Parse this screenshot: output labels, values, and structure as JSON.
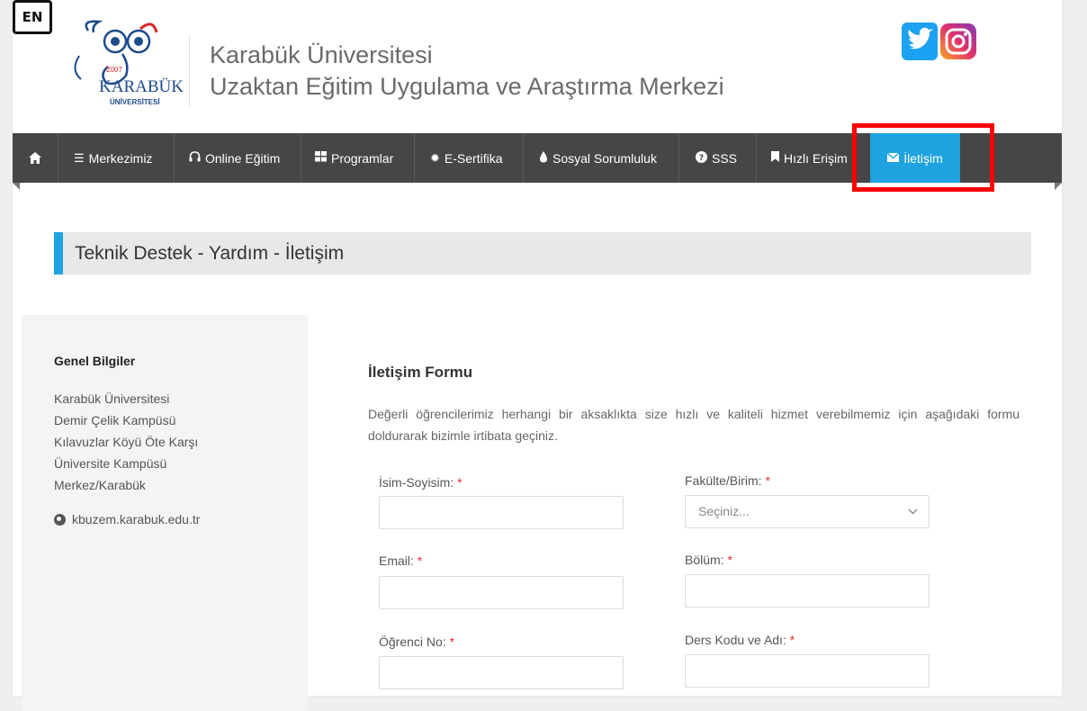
{
  "header": {
    "logo_year": "2007",
    "logo_name": "KARABÜK",
    "logo_sub": "ÜNİVERSİTESİ",
    "title_line1": "Karabük Üniversitesi",
    "title_line2": "Uzaktan Eğitim Uygulama ve Araştırma Merkezi",
    "lang_button": "EN"
  },
  "nav": {
    "items": [
      {
        "label": "Merkezimiz",
        "icon": "list-icon"
      },
      {
        "label": "Online Eğitim",
        "icon": "headphones-icon"
      },
      {
        "label": "Programlar",
        "icon": "grid-icon"
      },
      {
        "label": "E-Sertifika",
        "icon": "certificate-icon"
      },
      {
        "label": "Sosyal Sorumluluk",
        "icon": "drop-icon"
      },
      {
        "label": "SSS",
        "icon": "question-icon"
      },
      {
        "label": "Hızlı Erişim",
        "icon": "bookmark-icon"
      },
      {
        "label": "İletişim",
        "icon": "envelope-icon"
      }
    ],
    "active": "İletişim"
  },
  "section_title": "Teknik Destek - Yardım - İletişim",
  "sidebar": {
    "heading": "Genel Bilgiler",
    "address": [
      "Karabük Üniversitesi",
      "Demir Çelik Kampüsü",
      "Kılavuzlar Köyü Öte Karşı",
      "Üniversite Kampüsü",
      "Merkez/Karabük"
    ],
    "website": "kbuzem.karabuk.edu.tr"
  },
  "form": {
    "title": "İletişim Formu",
    "description": "Değerli öğrencilerimiz herhangi bir aksaklıkta size hızlı ve kaliteli hizmet verebilmemiz için aşağıdaki formu doldurarak bizimle irtibata geçiniz.",
    "required_mark": "*",
    "fields": {
      "name_label": "İsim-Soyisim:",
      "faculty_label": "Fakülte/Birim:",
      "faculty_placeholder": "Seçiniz...",
      "email_label": "Email:",
      "department_label": "Bölüm:",
      "student_no_label": "Öğrenci No:",
      "course_label": "Ders Kodu ve Adı:"
    }
  },
  "colors": {
    "nav_bg": "#464646",
    "accent": "#1fa3e0",
    "highlight": "#ff0000"
  }
}
